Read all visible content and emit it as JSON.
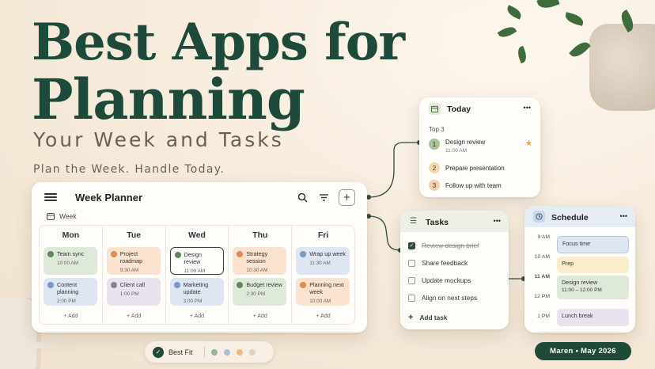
{
  "headline": {
    "line1": "Best Apps for",
    "line2": "Planning",
    "line3": "Your Week and Tasks",
    "tagline": "Plan the Week. Handle Today."
  },
  "week_planner": {
    "title": "Week Planner",
    "view_label": "Week",
    "add_label": "+ Add",
    "days": [
      {
        "name": "Mon",
        "events": [
          {
            "title": "Team sync",
            "time": "10:00 AM",
            "color": "green"
          },
          {
            "title": "Content planning",
            "time": "2:00 PM",
            "color": "blue"
          }
        ]
      },
      {
        "name": "Tue",
        "events": [
          {
            "title": "Project roadmap",
            "time": "9:30 AM",
            "color": "orange"
          },
          {
            "title": "Client call",
            "time": "1:00 PM",
            "color": "lav"
          }
        ]
      },
      {
        "name": "Wed",
        "events": [
          {
            "title": "Design review",
            "time": "11:00 AM",
            "color": "green"
          },
          {
            "title": "Marketing update",
            "time": "3:00 PM",
            "color": "blue"
          }
        ]
      },
      {
        "name": "Thu",
        "events": [
          {
            "title": "Strategy session",
            "time": "10:30 AM",
            "color": "orange"
          },
          {
            "title": "Budget review",
            "time": "2:30 PM",
            "color": "green"
          }
        ]
      },
      {
        "name": "Fri",
        "events": [
          {
            "title": "Wrap up week",
            "time": "11:30 AM",
            "color": "blue"
          },
          {
            "title": "Planning next week",
            "time": "10:00 AM",
            "color": "orange"
          }
        ]
      }
    ]
  },
  "today": {
    "title": "Today",
    "menu": "•••",
    "section": "Top 3",
    "items": [
      {
        "num": "1",
        "title": "Design review",
        "time": "11:00 AM"
      },
      {
        "num": "2",
        "title": "Prepare presentation"
      },
      {
        "num": "3",
        "title": "Follow up with team"
      }
    ]
  },
  "tasks": {
    "title": "Tasks",
    "menu": "•••",
    "items": [
      {
        "label": "Review design brief",
        "done": true
      },
      {
        "label": "Share feedback",
        "done": false
      },
      {
        "label": "Update mockups",
        "done": false
      },
      {
        "label": "Align on next steps",
        "done": false
      }
    ],
    "add_label": "Add task"
  },
  "schedule": {
    "title": "Schedule",
    "menu": "•••",
    "times": [
      "9 AM",
      "10 AM",
      "11 AM",
      "12 PM",
      "1 PM"
    ],
    "events": [
      {
        "title": "Focus time"
      },
      {
        "title": "Prep"
      },
      {
        "title": "Design review",
        "time": "11:00 – 12:00 PM"
      },
      {
        "title": "Lunch break"
      }
    ]
  },
  "footer": {
    "pill_label": "Best Fit",
    "dot_colors": [
      "#9bb58f",
      "#a9bfdc",
      "#f2b97a",
      "#d9d3cb"
    ],
    "signature": "Maren  •  May 2026"
  },
  "colors": {
    "brand": "#1d4a3a",
    "accent": "#2e4a3c"
  }
}
